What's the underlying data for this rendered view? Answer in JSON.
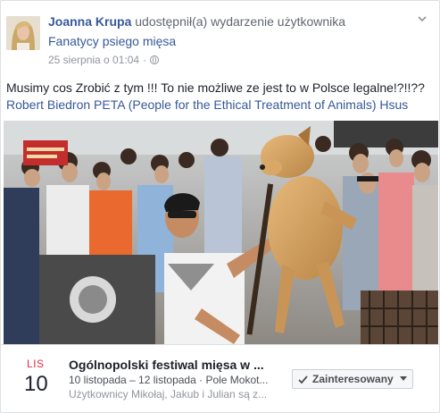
{
  "post": {
    "author": "Joanna Krupa",
    "shared_text": "udostępnił(a) wydarzenie użytkownika",
    "page_name": "Fanatycy psiego mięsa",
    "timestamp": "25 sierpnia o 01:04",
    "separator": "·",
    "privacy_icon": "globe-icon",
    "options_icon": "chevron-down-icon",
    "text_line1": "Musimy cos Zrobić z tym !!! To nie możliwe ze jest to w Polsce legalne!?!!??",
    "text_line2": "Robert Biedron PETA (People for the Ethical Treatment of Animals) Hsus"
  },
  "event": {
    "month": "LIS",
    "day": "10",
    "title": "Ogólnopolski festiwal mięsa w ...",
    "dates": "10 listopada – 12 listopada · Pole Mokot...",
    "friends": "Użytkownicy Mikołaj, Jakub i Julian są z...",
    "interested_label": "Zainteresowany",
    "interested_icon": "checkmark-icon"
  },
  "colors": {
    "link": "#365899",
    "month": "#f02849",
    "meta": "#90949c"
  }
}
